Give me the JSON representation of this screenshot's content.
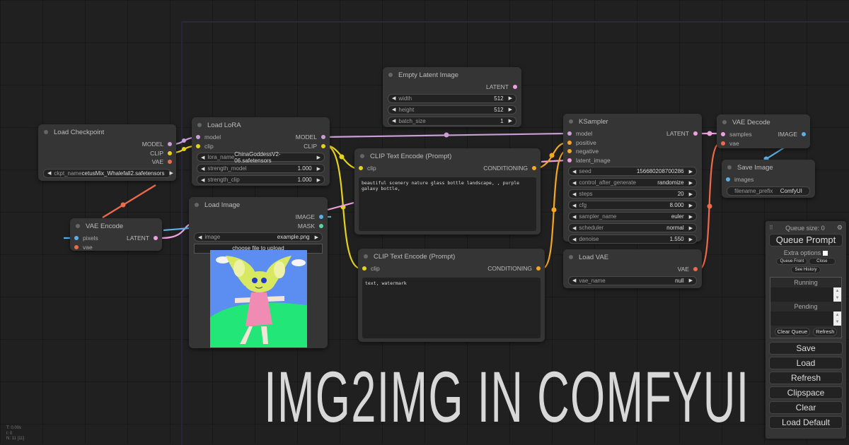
{
  "headline": "IMG2IMG IN COMFYUI",
  "colors": {
    "model": "#c89fd6",
    "clip": "#e6d21a",
    "vae": "#ef6a4b",
    "latent": "#f0a0e0",
    "image": "#5ab0e6",
    "mask": "#5ad3a0",
    "conditioning": "#f5a623"
  },
  "nodes": {
    "load_checkpoint": {
      "title": "Load Checkpoint",
      "outputs": [
        "MODEL",
        "CLIP",
        "VAE"
      ],
      "widgets": [
        {
          "name": "ckpt_name",
          "value": "cetusMix_Whalefall2.safetensors"
        }
      ]
    },
    "load_lora": {
      "title": "Load LoRA",
      "inputs": [
        "model",
        "clip"
      ],
      "outputs": [
        "MODEL",
        "CLIP"
      ],
      "widgets": [
        {
          "name": "lora_name",
          "value": "ChinaGoddessV2-06.safetensors"
        },
        {
          "name": "strength_model",
          "value": "1.000"
        },
        {
          "name": "strength_clip",
          "value": "1.000"
        }
      ]
    },
    "empty_latent": {
      "title": "Empty Latent Image",
      "outputs": [
        "LATENT"
      ],
      "widgets": [
        {
          "name": "width",
          "value": "512"
        },
        {
          "name": "height",
          "value": "512"
        },
        {
          "name": "batch_size",
          "value": "1"
        }
      ]
    },
    "clip_text_pos": {
      "title": "CLIP Text Encode (Prompt)",
      "inputs": [
        "clip"
      ],
      "outputs": [
        "CONDITIONING"
      ],
      "text": "beautiful scenery nature glass bottle landscape, , purple galaxy bottle,"
    },
    "clip_text_neg": {
      "title": "CLIP Text Encode (Prompt)",
      "inputs": [
        "clip"
      ],
      "outputs": [
        "CONDITIONING"
      ],
      "text": "text, watermark"
    },
    "ksampler": {
      "title": "KSampler",
      "inputs": [
        "model",
        "positive",
        "negative",
        "latent_image"
      ],
      "outputs": [
        "LATENT"
      ],
      "widgets": [
        {
          "name": "seed",
          "value": "156680208700286"
        },
        {
          "name": "control_after_generate",
          "value": "randomize"
        },
        {
          "name": "steps",
          "value": "20"
        },
        {
          "name": "cfg",
          "value": "8.000"
        },
        {
          "name": "sampler_name",
          "value": "euler"
        },
        {
          "name": "scheduler",
          "value": "normal"
        },
        {
          "name": "denoise",
          "value": "1.550"
        }
      ]
    },
    "vae_decode": {
      "title": "VAE Decode",
      "inputs": [
        "samples",
        "vae"
      ],
      "outputs": [
        "IMAGE"
      ]
    },
    "save_image": {
      "title": "Save Image",
      "inputs": [
        "images"
      ],
      "widgets": [
        {
          "name": "filename_prefix",
          "value": "ComfyUI"
        }
      ]
    },
    "load_vae": {
      "title": "Load VAE",
      "outputs": [
        "VAE"
      ],
      "widgets": [
        {
          "name": "vae_name",
          "value": "null"
        }
      ]
    },
    "load_image": {
      "title": "Load Image",
      "outputs": [
        "IMAGE",
        "MASK"
      ],
      "widgets": [
        {
          "name": "image",
          "value": "example.png"
        }
      ],
      "upload_label": "choose file to upload"
    },
    "vae_encode": {
      "title": "VAE Encode",
      "inputs": [
        "pixels",
        "vae"
      ],
      "outputs": [
        "LATENT"
      ]
    }
  },
  "panel": {
    "queue_size": "Queue size: 0",
    "queue_prompt": "Queue Prompt",
    "extra_options": "Extra options",
    "queue_front": "Queue Front",
    "close": "Close",
    "see_history": "See History",
    "running": "Running",
    "pending": "Pending",
    "clear_queue": "Clear Queue",
    "refresh_small": "Refresh",
    "buttons": [
      "Save",
      "Load",
      "Refresh",
      "Clipspace",
      "Clear",
      "Load Default"
    ]
  },
  "stats": [
    "T: 0.00s",
    "I: 0",
    "N: 11 [11]"
  ]
}
